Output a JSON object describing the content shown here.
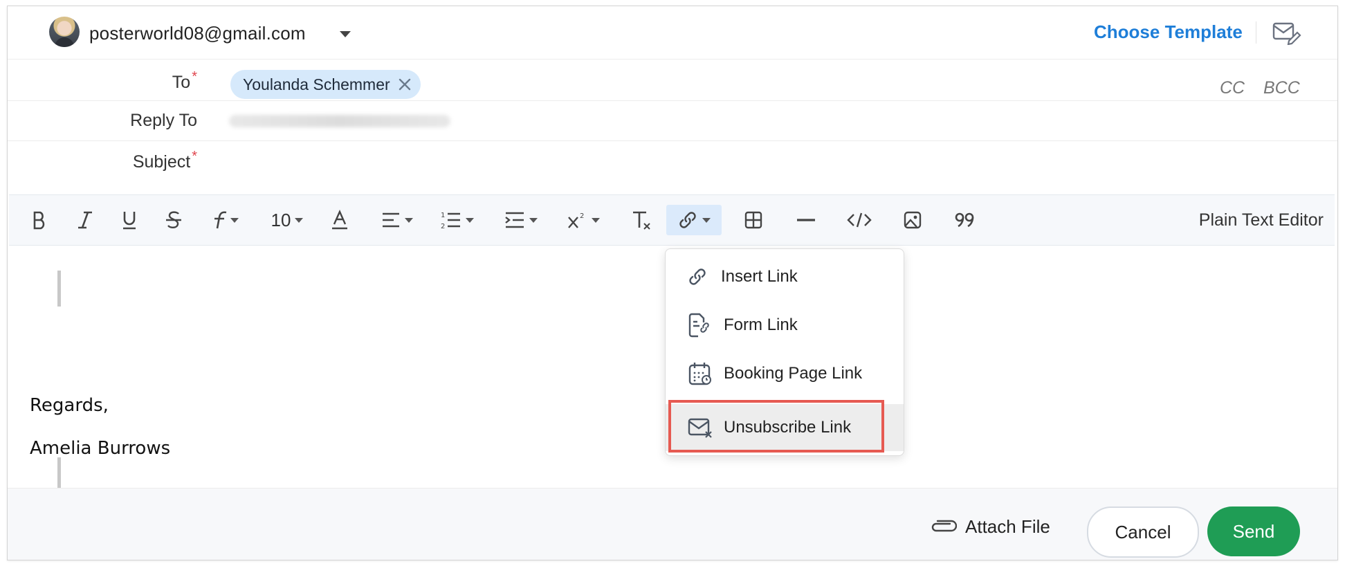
{
  "header": {
    "from_email": "posterworld08@gmail.com",
    "choose_template": "Choose Template"
  },
  "fields": {
    "to_label": "To",
    "to_chip": "Youlanda Schemmer",
    "cc": "CC",
    "bcc": "BCC",
    "reply_to_label": "Reply To",
    "subject_label": "Subject",
    "required_mark": "*"
  },
  "toolbar": {
    "font_size": "10",
    "plain_text_editor": "Plain Text Editor",
    "items": [
      "bold-icon",
      "italic-icon",
      "underline-icon",
      "strikethrough-icon",
      "font-family-icon",
      "font-size",
      "text-color-icon",
      "align-icon",
      "list-icon",
      "indent-icon",
      "superscript-icon",
      "clear-format-icon",
      "link-icon",
      "table-icon",
      "horizontal-line-icon",
      "code-icon",
      "image-icon",
      "quote-icon"
    ]
  },
  "link_menu": {
    "items": [
      {
        "label": "Insert Link",
        "icon": "link-icon"
      },
      {
        "label": "Form Link",
        "icon": "form-link-icon"
      },
      {
        "label": "Booking Page Link",
        "icon": "calendar-icon"
      },
      {
        "label": "Unsubscribe Link",
        "icon": "mail-x-icon"
      }
    ]
  },
  "signature": {
    "line1": "Regards,",
    "line2": "Amelia Burrows"
  },
  "footer": {
    "attach_file": "Attach File",
    "cancel": "Cancel",
    "send": "Send"
  },
  "colors": {
    "accent": "#1e7ed8",
    "send_green": "#1f9d55",
    "highlight_red": "#e65a52",
    "chip_bg": "#d6e9fb"
  }
}
